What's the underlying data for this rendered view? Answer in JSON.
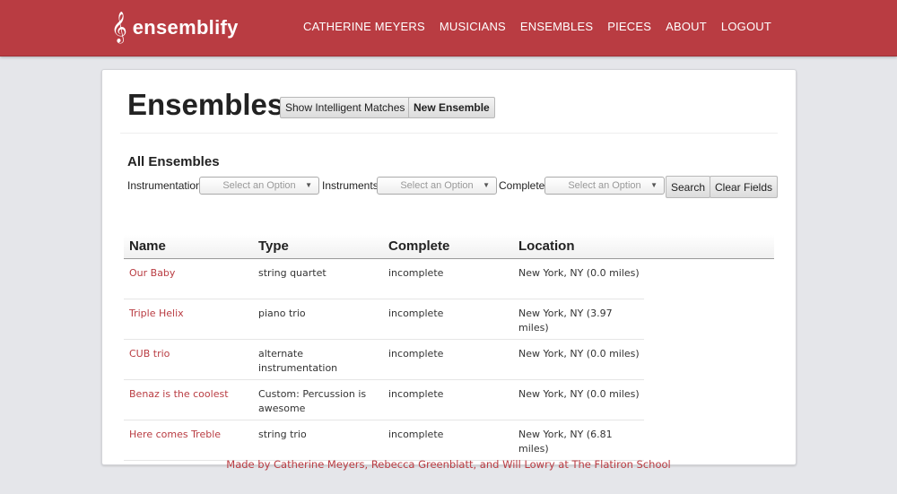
{
  "brand": {
    "icon": "treble-clef-icon",
    "glyph": "𝄞",
    "name": "ensemblify"
  },
  "nav": {
    "items": [
      "CATHERINE MEYERS",
      "MUSICIANS",
      "ENSEMBLES",
      "PIECES",
      "ABOUT",
      "LOGOUT"
    ]
  },
  "page": {
    "title": "Ensembles",
    "show_matches_label": "Show Intelligent Matches",
    "new_ensemble_label": "New Ensemble"
  },
  "filters": {
    "section_title": "All Ensembles",
    "instrumentation_label": "Instrumentation",
    "instruments_label": "Instruments",
    "complete_label": "Complete",
    "placeholder": "Select an Option",
    "search_label": "Search",
    "clear_label": "Clear Fields"
  },
  "table": {
    "headers": [
      "Name",
      "Type",
      "Complete",
      "Location"
    ],
    "rows": [
      {
        "name": "Our Baby",
        "type": "string quartet",
        "complete": "incomplete",
        "location": "New York, NY (0.0 miles)"
      },
      {
        "name": "Triple Helix",
        "type": "piano trio",
        "complete": "incomplete",
        "location": "New York, NY (3.97 miles)"
      },
      {
        "name": "CUB trio",
        "type": "alternate instrumentation",
        "complete": "incomplete",
        "location": "New York, NY (0.0 miles)"
      },
      {
        "name": "Benaz is the coolest",
        "type": "Custom: Percussion is awesome",
        "complete": "incomplete",
        "location": "New York, NY (0.0 miles)"
      },
      {
        "name": "Here comes Treble",
        "type": "string trio",
        "complete": "incomplete",
        "location": "New York, NY (6.81 miles)"
      }
    ]
  },
  "footer": {
    "text": "Made by Catherine Meyers, Rebecca Greenblatt, and Will Lowry at The Flatiron School"
  },
  "colors": {
    "brand": "#b93c42",
    "background": "#e5e6ea"
  }
}
